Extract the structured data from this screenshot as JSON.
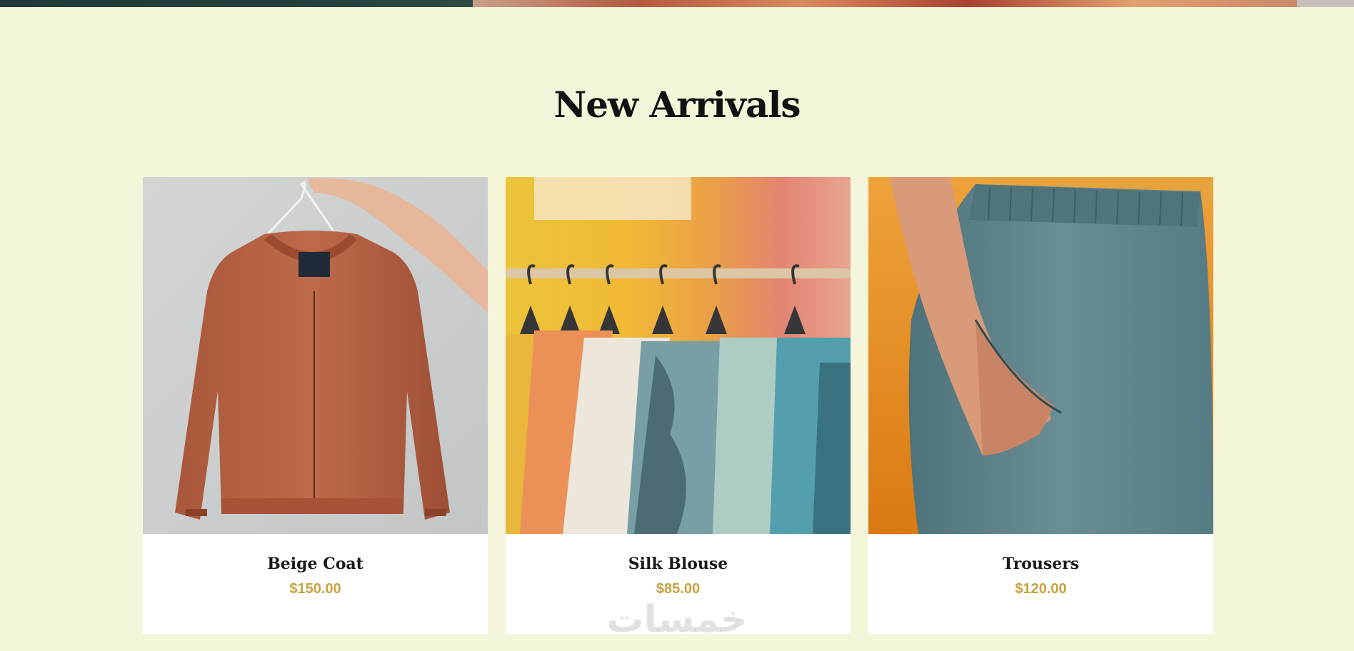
{
  "section": {
    "title": "New Arrivals"
  },
  "products": [
    {
      "name": "Beige Coat",
      "price": "$150.00",
      "image": "orange bomber jacket on hanger"
    },
    {
      "name": "Silk Blouse",
      "price": "$85.00",
      "image": "puffer jackets on clothing rack"
    },
    {
      "name": "Trousers",
      "price": "$120.00",
      "image": "person with hand in pocket of grey-blue trousers"
    }
  ],
  "watermark": "خمسات",
  "colors": {
    "page_background": "#f5f5da",
    "card_background": "#ffffff",
    "price": "#c9a23f",
    "heading": "#111111"
  }
}
